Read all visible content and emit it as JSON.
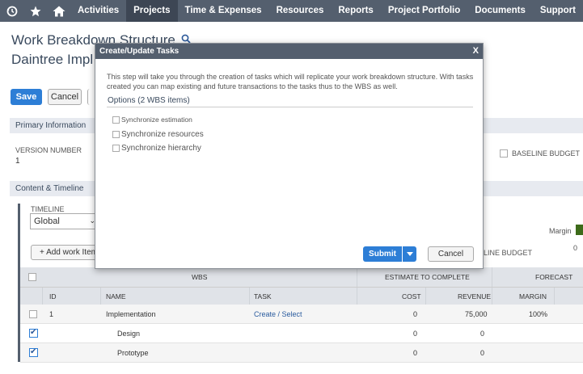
{
  "nav": {
    "icons": [
      "recent-icon",
      "star-icon",
      "home-icon"
    ],
    "items": [
      {
        "label": "Activities",
        "active": false
      },
      {
        "label": "Projects",
        "active": true
      },
      {
        "label": "Time & Expenses",
        "active": false
      },
      {
        "label": "Resources",
        "active": false
      },
      {
        "label": "Reports",
        "active": false
      },
      {
        "label": "Project Portfolio",
        "active": false
      },
      {
        "label": "Documents",
        "active": false
      },
      {
        "label": "Support",
        "active": false
      }
    ]
  },
  "page": {
    "title_line1": "Work Breakdown Structure",
    "title_line2": "Daintree Impl",
    "save_label": "Save",
    "cancel_label": "Cancel"
  },
  "primary": {
    "header": "Primary Information",
    "version_label": "VERSION NUMBER",
    "version_value": "1",
    "baseline_label": "BASELINE BUDGET"
  },
  "content": {
    "header": "Content & Timeline",
    "timeline_label": "TIMELINE",
    "timeline_value": "Global",
    "add_work_label": "+ Add work Item",
    "margin_label": "Margin",
    "margin_zero": "0",
    "line_budget_label": "LINE BUDGET"
  },
  "table": {
    "group_wbs": "WBS",
    "group_etc": "ESTIMATE TO COMPLETE",
    "group_forecast": "FORECAST",
    "col_id": "ID",
    "col_name": "NAME",
    "col_task": "TASK",
    "col_cost": "COST",
    "col_revenue": "REVENUE",
    "col_margin": "MARGIN",
    "rows": [
      {
        "checked": false,
        "id": "1",
        "name": "Implementation",
        "task": "Create / Select",
        "cost": "0",
        "revenue": "75,000",
        "margin": "100%"
      },
      {
        "checked": true,
        "id": "",
        "name": "Design",
        "task": "",
        "cost": "0",
        "revenue": "0",
        "margin": ""
      },
      {
        "checked": true,
        "id": "",
        "name": "Prototype",
        "task": "",
        "cost": "0",
        "revenue": "0",
        "margin": ""
      }
    ]
  },
  "modal": {
    "title": "Create/Update Tasks",
    "close": "X",
    "description": "This step will take you through the creation of tasks which will replicate your work breakdown structure. With tasks created you can map existing and future transactions to the tasks thus to the WBS as well.",
    "options_title": "Options (2 WBS items)",
    "options": [
      {
        "label": "Synchronize estimation",
        "checked": false
      },
      {
        "label": "Synchronize resources",
        "checked": false
      },
      {
        "label": "Synchronize hierarchy",
        "checked": false
      }
    ],
    "submit_label": "Submit",
    "cancel_label": "Cancel"
  },
  "colors": {
    "nav_bg": "#545f6e",
    "accent": "#2d7ed6",
    "link": "#2a5b9e",
    "margin_bar": "#3d6b1a"
  }
}
